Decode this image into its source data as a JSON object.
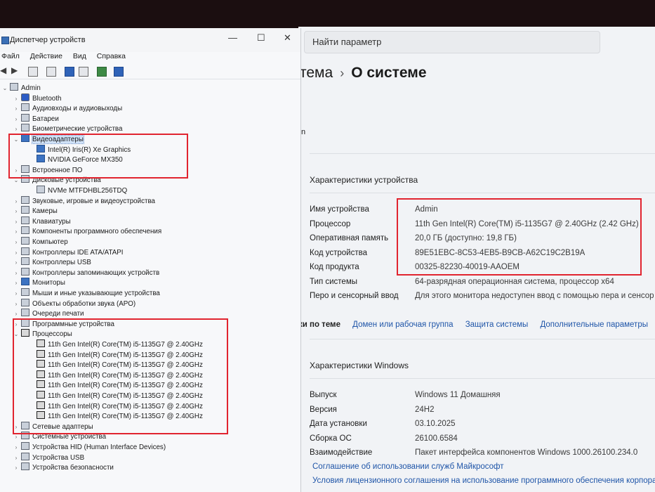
{
  "settings": {
    "search_placeholder": "Найти параметр",
    "breadcrumb_parent": "тема",
    "breadcrumb_current": "О системе",
    "stray_char": "n",
    "device_spec_title": "Характеристики устройства",
    "device_spec": [
      {
        "key": "Имя устройства",
        "value": "Admin"
      },
      {
        "key": "Процессор",
        "value": "11th Gen Intel(R) Core(TM) i5-1135G7 @ 2.40GHz (2.42 GHz)"
      },
      {
        "key": "Оперативная память",
        "value": "20,0 ГБ (доступно: 19,8 ГБ)"
      },
      {
        "key": "Код устройства",
        "value": "89E51EBC-8C53-4EB5-B9CB-A62C19C2B19A"
      },
      {
        "key": "Код продукта",
        "value": "00325-82230-40019-AAOEM"
      },
      {
        "key": "Тип системы",
        "value": "64-разрядная операционная система, процессор x64"
      },
      {
        "key": "Перо и сенсорный ввод",
        "value": "Для этого монитора недоступен ввод с помощью пера и сенсор"
      }
    ],
    "links": {
      "related": "ки по теме",
      "domain": "Домен или рабочая группа",
      "protection": "Защита системы",
      "advanced": "Дополнительные параметры"
    },
    "windows_spec_title": "Характеристики Windows",
    "windows_spec": [
      {
        "key": "Выпуск",
        "value": "Windows 11 Домашняя"
      },
      {
        "key": "Версия",
        "value": "24H2"
      },
      {
        "key": "Дата установки",
        "value": "03.10.2025"
      },
      {
        "key": "Сборка ОС",
        "value": "26100.6584"
      },
      {
        "key": "Взаимодействие",
        "value": "Пакет интерфейса компонентов Windows 1000.26100.234.0"
      }
    ],
    "agreement_links": [
      "Соглашение об использовании служб Майкрософт",
      "Условия лицензионного соглашения на использование программного обеспечения корпора"
    ]
  },
  "devmgr": {
    "title": "Диспетчер устройств",
    "window_controls": {
      "minimize": "—",
      "maximize": "☐",
      "close": "✕"
    },
    "menu": [
      "Файл",
      "Действие",
      "Вид",
      "Справка"
    ],
    "tree": [
      {
        "label": "Admin",
        "exp": "v",
        "icon": "computer"
      },
      {
        "label": "Bluetooth",
        "exp": ">",
        "icon": "bluetooth"
      },
      {
        "label": "Аудиовходы и аудиовыходы",
        "exp": ">",
        "icon": "audio"
      },
      {
        "label": "Батареи",
        "exp": ">",
        "icon": "battery"
      },
      {
        "label": "Биометрические устройства",
        "exp": ">",
        "icon": "biometric"
      },
      {
        "label": "Видеоадаптеры",
        "exp": "v",
        "icon": "monitor",
        "selected": true
      },
      {
        "label": "Intel(R) Iris(R) Xe Graphics",
        "exp": "",
        "icon": "monitor"
      },
      {
        "label": "NVIDIA GeForce MX350",
        "exp": "",
        "icon": "monitor"
      },
      {
        "label": "Встроенное ПО",
        "exp": ">",
        "icon": "firmware"
      },
      {
        "label": "Дисковые устройства",
        "exp": "v",
        "icon": "disk"
      },
      {
        "label": "NVMe MTFDHBL256TDQ",
        "exp": "",
        "icon": "disk"
      },
      {
        "label": "Звуковые, игровые и видеоустройства",
        "exp": ">",
        "icon": "sound"
      },
      {
        "label": "Камеры",
        "exp": ">",
        "icon": "camera"
      },
      {
        "label": "Клавиатуры",
        "exp": ">",
        "icon": "keyboard"
      },
      {
        "label": "Компоненты программного обеспечения",
        "exp": ">",
        "icon": "software"
      },
      {
        "label": "Компьютер",
        "exp": ">",
        "icon": "computer"
      },
      {
        "label": "Контроллеры IDE ATA/ATAPI",
        "exp": ">",
        "icon": "ide"
      },
      {
        "label": "Контроллеры USB",
        "exp": ">",
        "icon": "usb"
      },
      {
        "label": "Контроллеры запоминающих устройств",
        "exp": ">",
        "icon": "storage"
      },
      {
        "label": "Мониторы",
        "exp": ">",
        "icon": "monitor"
      },
      {
        "label": "Мыши и иные указывающие устройства",
        "exp": ">",
        "icon": "mouse"
      },
      {
        "label": "Объекты обработки звука (APO)",
        "exp": ">",
        "icon": "apo"
      },
      {
        "label": "Очереди печати",
        "exp": ">",
        "icon": "printer"
      },
      {
        "label": "Программные устройства",
        "exp": ">",
        "icon": "software"
      },
      {
        "label": "Процессоры",
        "exp": "v",
        "icon": "cpu"
      },
      {
        "label": "11th Gen Intel(R) Core(TM) i5-1135G7 @ 2.40GHz",
        "exp": "",
        "icon": "cpu"
      },
      {
        "label": "11th Gen Intel(R) Core(TM) i5-1135G7 @ 2.40GHz",
        "exp": "",
        "icon": "cpu"
      },
      {
        "label": "11th Gen Intel(R) Core(TM) i5-1135G7 @ 2.40GHz",
        "exp": "",
        "icon": "cpu"
      },
      {
        "label": "11th Gen Intel(R) Core(TM) i5-1135G7 @ 2.40GHz",
        "exp": "",
        "icon": "cpu"
      },
      {
        "label": "11th Gen Intel(R) Core(TM) i5-1135G7 @ 2.40GHz",
        "exp": "",
        "icon": "cpu"
      },
      {
        "label": "11th Gen Intel(R) Core(TM) i5-1135G7 @ 2.40GHz",
        "exp": "",
        "icon": "cpu"
      },
      {
        "label": "11th Gen Intel(R) Core(TM) i5-1135G7 @ 2.40GHz",
        "exp": "",
        "icon": "cpu"
      },
      {
        "label": "11th Gen Intel(R) Core(TM) i5-1135G7 @ 2.40GHz",
        "exp": "",
        "icon": "cpu"
      },
      {
        "label": "Сетевые адаптеры",
        "exp": ">",
        "icon": "network"
      },
      {
        "label": "Системные устройства",
        "exp": ">",
        "icon": "system"
      },
      {
        "label": "Устройства HID (Human Interface Devices)",
        "exp": ">",
        "icon": "hid"
      },
      {
        "label": "Устройства USB",
        "exp": ">",
        "icon": "usb"
      },
      {
        "label": "Устройства безопасности",
        "exp": ">",
        "icon": "security"
      }
    ]
  },
  "colors": {
    "highlight_box": "#e1242f",
    "link": "#1f55a8"
  }
}
